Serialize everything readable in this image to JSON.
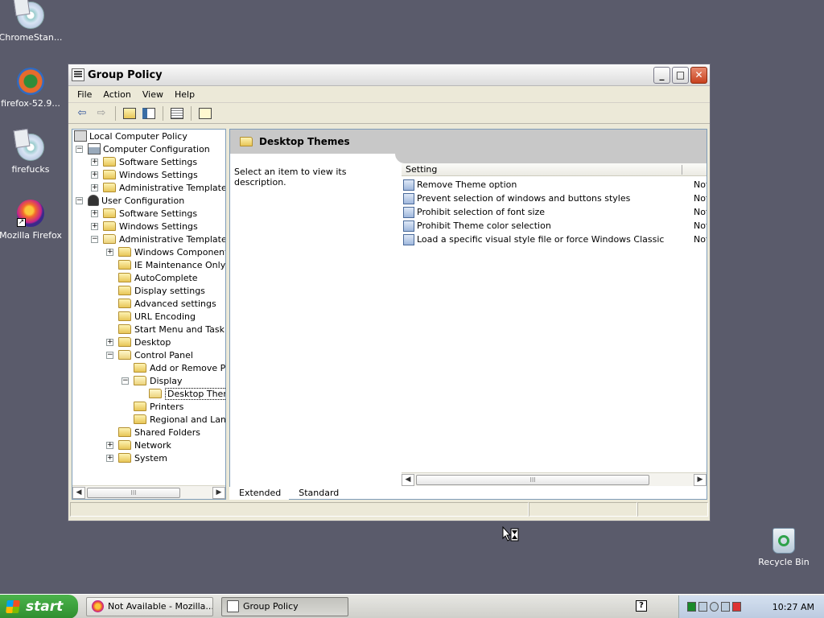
{
  "desktop": {
    "icons": [
      {
        "label": "ChromeStan..."
      },
      {
        "label": "firefox-52.9..."
      },
      {
        "label": "firefucks"
      },
      {
        "label": "Mozilla Firefox"
      },
      {
        "label": "Recycle Bin"
      }
    ]
  },
  "window": {
    "title": "Group Policy",
    "menu": [
      "File",
      "Action",
      "View",
      "Help"
    ],
    "tree": {
      "root": "Local Computer Policy",
      "computer_config": "Computer Configuration",
      "cc_software": "Software Settings",
      "cc_windows": "Windows Settings",
      "cc_admin": "Administrative Templates",
      "user_config": "User Configuration",
      "uc_software": "Software Settings",
      "uc_windows": "Windows Settings",
      "uc_admin": "Administrative Templates",
      "windows_components": "Windows Components",
      "ie_maintenance": "IE Maintenance Only",
      "autocomplete": "AutoComplete",
      "display_settings": "Display settings",
      "advanced_settings": "Advanced settings",
      "url_encoding": "URL Encoding",
      "start_menu": "Start Menu and Taskbar",
      "desktop": "Desktop",
      "control_panel": "Control Panel",
      "add_remove": "Add or Remove Pro",
      "display": "Display",
      "desktop_themes": "Desktop Theme",
      "printers": "Printers",
      "regional": "Regional and Langu",
      "shared_folders": "Shared Folders",
      "network": "Network",
      "system": "System"
    },
    "detail": {
      "header": "Desktop Themes",
      "description": "Select an item to view its description.",
      "column_setting": "Setting",
      "rows": [
        {
          "setting": "Remove Theme option",
          "state": "Not"
        },
        {
          "setting": "Prevent selection of windows and buttons styles",
          "state": "Not"
        },
        {
          "setting": "Prohibit selection of font size",
          "state": "Not"
        },
        {
          "setting": "Prohibit Theme color selection",
          "state": "Not"
        },
        {
          "setting": "Load a specific visual style file or force Windows Classic",
          "state": "Not"
        }
      ]
    },
    "tabs": [
      "Extended",
      "Standard"
    ]
  },
  "taskbar": {
    "start": "start",
    "tasks": [
      {
        "label": "Not Available - Mozilla..."
      },
      {
        "label": "Group Policy"
      }
    ],
    "help_glyph": "?",
    "clock": "10:27 AM"
  }
}
